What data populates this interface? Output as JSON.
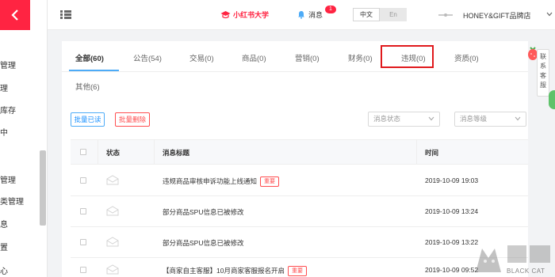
{
  "sidebar": {
    "items": [
      "管理",
      "理",
      "库存",
      "中",
      "管理",
      "类管理",
      "息",
      "置",
      "心"
    ]
  },
  "header": {
    "brand": "小红书大学",
    "messages_label": "消息",
    "messages_count": "1",
    "lang_zh": "中文",
    "lang_en": "En",
    "shop_name": "HONEY&GIFT品牌店"
  },
  "tabs": [
    {
      "label": "全部(60)",
      "active": true
    },
    {
      "label": "公告(54)",
      "active": false
    },
    {
      "label": "交易(0)",
      "active": false
    },
    {
      "label": "商品(0)",
      "active": false
    },
    {
      "label": "营销(0)",
      "active": false
    },
    {
      "label": "财务(0)",
      "active": false
    },
    {
      "label": "违规(0)",
      "active": false
    },
    {
      "label": "资质(0)",
      "active": false
    },
    {
      "label": "其他(6)",
      "active": false
    }
  ],
  "actions": {
    "mark_read": "批量已读",
    "delete": "批量删除"
  },
  "filters": {
    "status_placeholder": "消息状态",
    "level_placeholder": "消息等级"
  },
  "table": {
    "columns": [
      "状态",
      "消息标题",
      "时间"
    ],
    "rows": [
      {
        "title": "违规商品审核申诉功能上线通知",
        "tag": "重要",
        "time": "2019-10-09 19:03"
      },
      {
        "title": "部分商品SPU信息已被修改",
        "tag": "",
        "time": "2019-10-09 13:24"
      },
      {
        "title": "部分商品SPU信息已被修改",
        "tag": "",
        "time": "2019-10-09 13:22"
      },
      {
        "title": "【商家自主客服】10月商家客服报名开启",
        "tag": "重要",
        "time": "2019-10-09 09:52"
      }
    ]
  },
  "service_widget": {
    "label": [
      "联",
      "系",
      "客",
      "服"
    ]
  },
  "watermark": {
    "text": "BLACK CAT"
  },
  "colors": {
    "brand_red": "#ff2442",
    "tab_active_underline": "#4dabf7",
    "highlight_box": "#e0191c"
  }
}
